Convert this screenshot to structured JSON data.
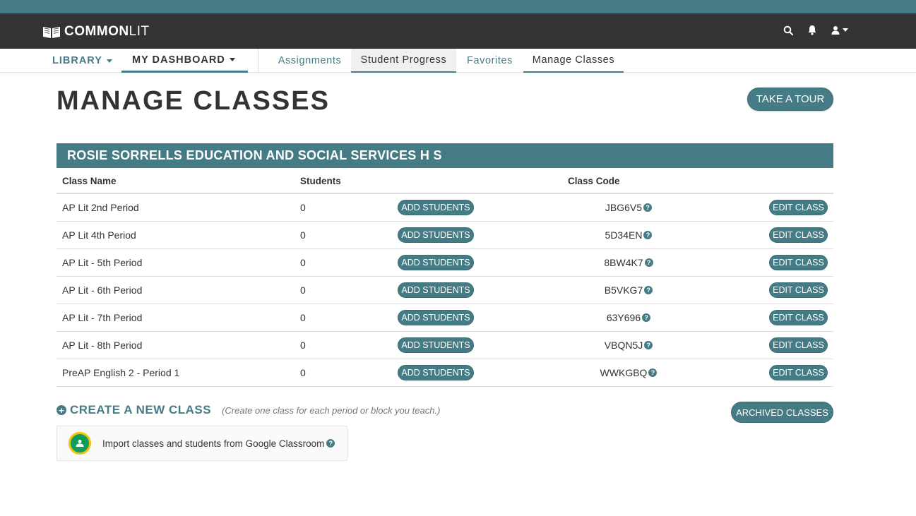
{
  "colors": {
    "brand": "#457b85",
    "navbar": "#333333",
    "google_green": "#0f9d58",
    "google_yellow": "#f4c20d"
  },
  "navbar": {
    "logo_bold": "COMMON",
    "logo_regular": "LIT",
    "icons": [
      "search-icon",
      "bell-icon",
      "user-icon"
    ]
  },
  "subnav": {
    "library": "LIBRARY",
    "dashboard": "MY DASHBOARD",
    "tabs": [
      {
        "label": "Assignments"
      },
      {
        "label": "Student Progress"
      },
      {
        "label": "Favorites"
      },
      {
        "label": "Manage Classes"
      }
    ]
  },
  "page": {
    "title": "MANAGE CLASSES",
    "tour_button": "TAKE A TOUR",
    "school": "ROSIE SORRELLS EDUCATION AND SOCIAL SERVICES H S"
  },
  "table": {
    "headers": {
      "class_name": "Class Name",
      "students": "Students",
      "class_code": "Class Code"
    },
    "add_label": "ADD STUDENTS",
    "edit_label": "EDIT CLASS",
    "rows": [
      {
        "name": "AP Lit 2nd Period",
        "students": "0",
        "code": "JBG6V5"
      },
      {
        "name": "AP Lit 4th Period",
        "students": "0",
        "code": "5D34EN"
      },
      {
        "name": "AP Lit - 5th Period",
        "students": "0",
        "code": "8BW4K7"
      },
      {
        "name": "AP Lit - 6th Period",
        "students": "0",
        "code": "B5VKG7"
      },
      {
        "name": "AP Lit - 7th Period",
        "students": "0",
        "code": "63Y696"
      },
      {
        "name": "AP Lit - 8th Period",
        "students": "0",
        "code": "VBQN5J"
      },
      {
        "name": "PreAP English 2 - Period 1",
        "students": "0",
        "code": "WWKGBQ"
      }
    ]
  },
  "create": {
    "label": "CREATE A NEW CLASS",
    "hint": "(Create one class for each period or block you teach.)",
    "archived_button": "ARCHIVED CLASSES"
  },
  "google": {
    "text": "Import classes and students from Google Classroom"
  }
}
